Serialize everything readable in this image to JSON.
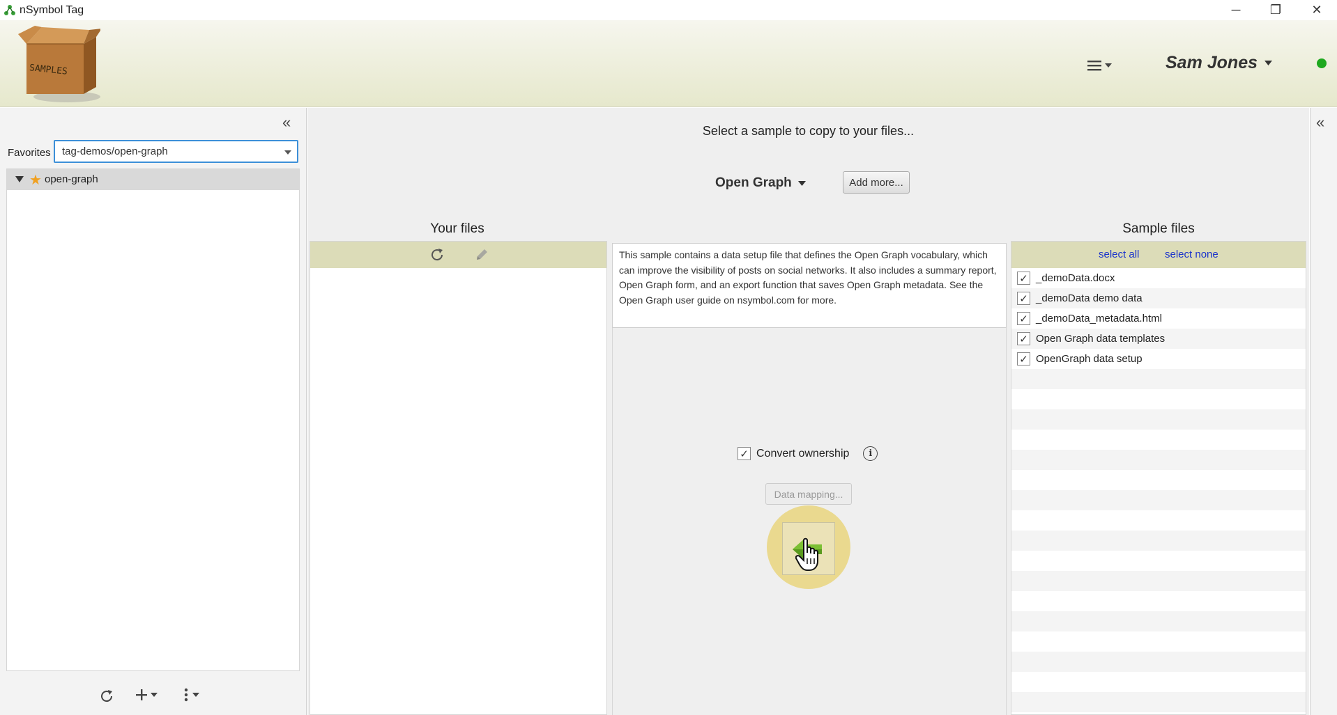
{
  "window": {
    "title": "nSymbol Tag",
    "controls": {
      "minimize": "─",
      "restore": "❐",
      "close": "✕"
    }
  },
  "header": {
    "logo_text": "SAMPLES",
    "user_name": "Sam Jones",
    "status_color": "#1ea81e"
  },
  "left_panel": {
    "favorites_label": "Favorites",
    "favorites_value": "tag-demos/open-graph",
    "tree": [
      {
        "label": "open-graph",
        "starred": true,
        "expanded": true
      }
    ]
  },
  "center": {
    "title": "Select a sample to copy to your files...",
    "sample_selected": "Open Graph",
    "add_more_label": "Add more...",
    "description": "This sample contains a data setup file that defines the Open Graph vocabulary, which can improve the visibility of posts on social networks. It also includes a summary report, Open Graph form, and an export function that saves Open Graph metadata. See the Open Graph user guide on nsymbol.com for more.",
    "convert_ownership_label": "Convert ownership",
    "convert_ownership_checked": true,
    "data_mapping_label": "Data mapping..."
  },
  "your_files": {
    "title": "Your files"
  },
  "sample_files": {
    "title": "Sample files",
    "select_all": "select all",
    "select_none": "select none",
    "items": [
      {
        "name": "_demoData.docx",
        "checked": true
      },
      {
        "name": "_demoData demo data",
        "checked": true
      },
      {
        "name": "_demoData_metadata.html",
        "checked": true
      },
      {
        "name": "Open Graph data templates",
        "checked": true
      },
      {
        "name": "OpenGraph data setup",
        "checked": true
      }
    ]
  },
  "colors": {
    "accent_blue": "#3c8fd8",
    "toolbar_olive": "#dcdcb8",
    "link_blue": "#1a33cc",
    "highlight_yellow": "#e6cd5a"
  }
}
